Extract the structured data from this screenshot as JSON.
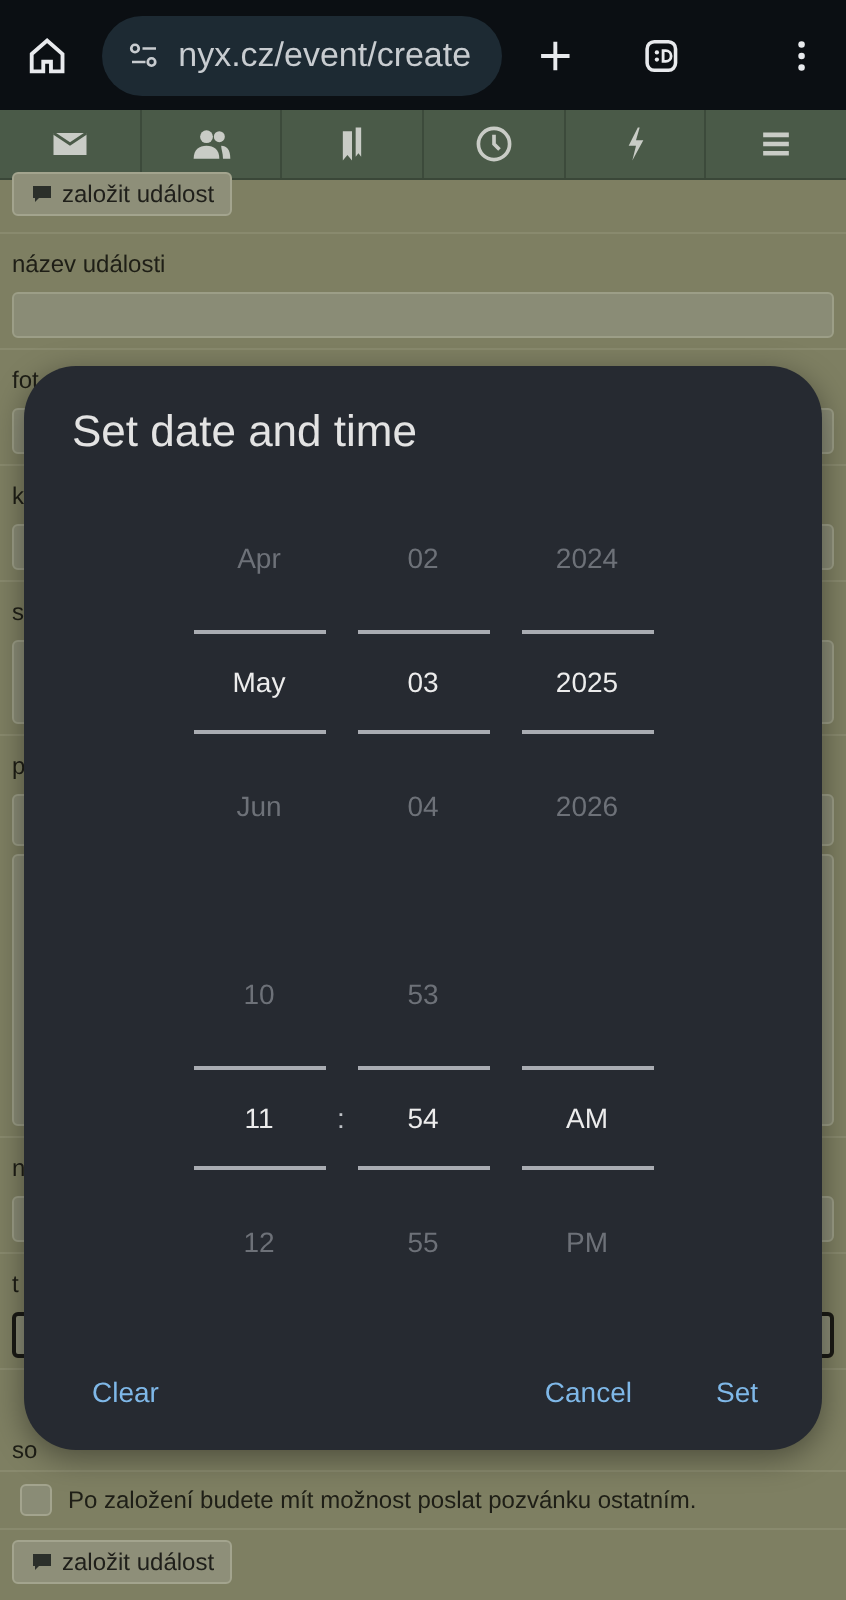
{
  "browser": {
    "url": "nyx.cz/event/create"
  },
  "nav_tabs": [
    {
      "kind": "mail"
    },
    {
      "kind": "people"
    },
    {
      "kind": "bookmarks"
    },
    {
      "kind": "clock"
    },
    {
      "kind": "bolt"
    },
    {
      "kind": "menu"
    }
  ],
  "form": {
    "top_button": "založit událost",
    "sections": [
      {
        "label": "název události",
        "kind": "input"
      },
      {
        "label": "fot",
        "kind": "input"
      },
      {
        "label": "k",
        "kind": "input"
      },
      {
        "label": "s",
        "kind": "textarea"
      },
      {
        "label": "p",
        "kind": "editor"
      },
      {
        "label": "n",
        "kind": "input"
      },
      {
        "label": "t",
        "kind": "focused"
      },
      {
        "label": "so",
        "kind": "none"
      }
    ],
    "checkbox": {
      "label": "Po založení budete mít možnost poslat pozvánku ostatním.",
      "checked": false
    },
    "bottom_button": "založit událost"
  },
  "dialog": {
    "title": "Set date and time",
    "date_columns": [
      {
        "items": [
          {
            "text": "Apr",
            "selected": false
          },
          {
            "text": "May",
            "selected": true
          },
          {
            "text": "Jun",
            "selected": false
          }
        ]
      },
      {
        "items": [
          {
            "text": "02",
            "selected": false
          },
          {
            "text": "03",
            "selected": true
          },
          {
            "text": "04",
            "selected": false
          }
        ]
      },
      {
        "items": [
          {
            "text": "2024",
            "selected": false
          },
          {
            "text": "2025",
            "selected": true
          },
          {
            "text": "2026",
            "selected": false
          }
        ]
      }
    ],
    "time_separator": ":",
    "time_columns": [
      {
        "items": [
          {
            "text": "10",
            "selected": false
          },
          {
            "text": "11",
            "selected": true
          },
          {
            "text": "12",
            "selected": false
          }
        ]
      },
      {
        "items": [
          {
            "text": "53",
            "selected": false
          },
          {
            "text": "54",
            "selected": true
          },
          {
            "text": "55",
            "selected": false
          }
        ]
      },
      {
        "items": [
          {
            "text": "AM",
            "selected": true
          },
          {
            "text": "PM",
            "selected": false
          }
        ]
      }
    ],
    "buttons": [
      {
        "label": "Clear",
        "kind": "left"
      },
      {
        "label": "Cancel",
        "kind": "right"
      },
      {
        "label": "Set",
        "kind": "right"
      }
    ]
  }
}
